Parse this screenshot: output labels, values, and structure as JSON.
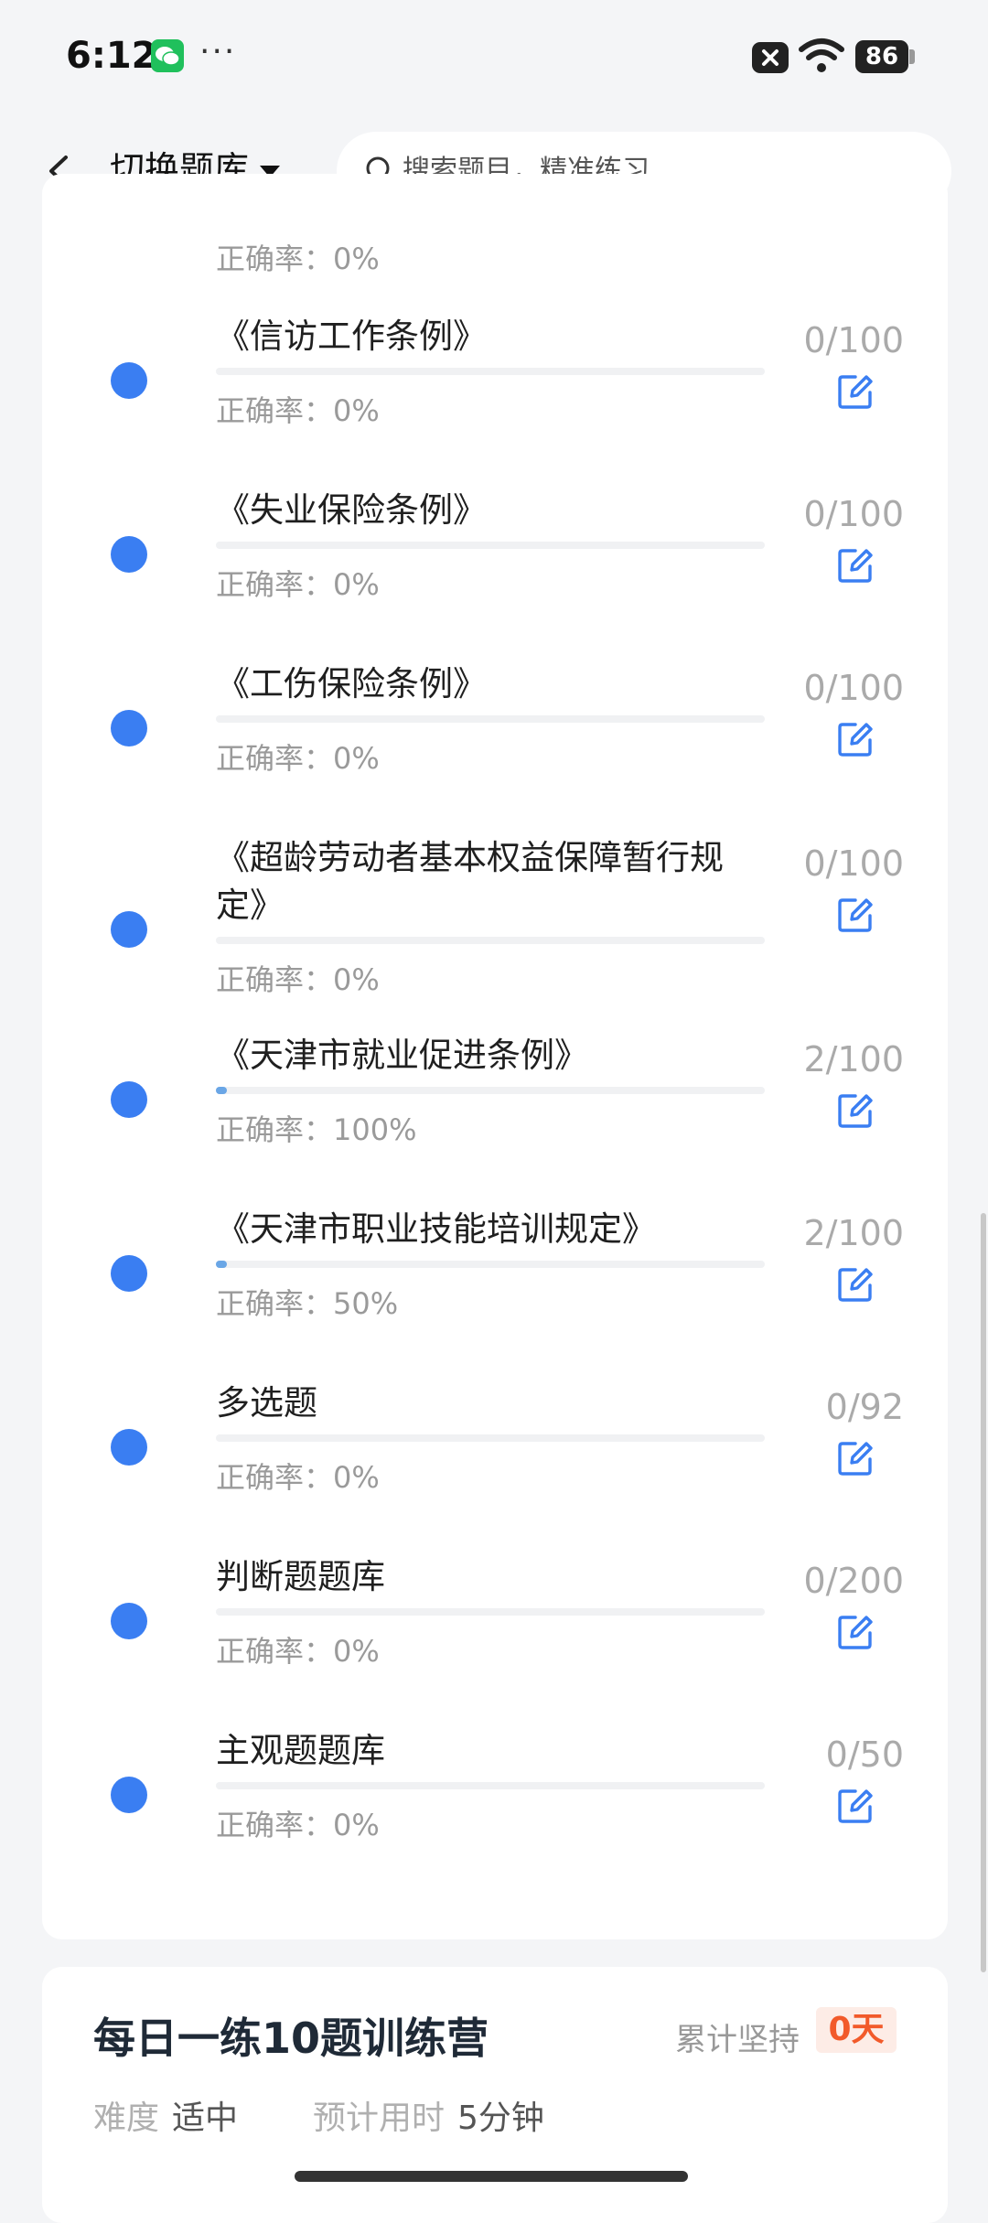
{
  "status": {
    "time": "6:12",
    "dots": "···",
    "battery": "86"
  },
  "header": {
    "title": "切换题库",
    "search_placeholder": "搜索题目，精准练习"
  },
  "partial_top_accuracy": "0%",
  "accuracy_label": "正确率：",
  "items": [
    {
      "title": "《信访工作条例》",
      "count": "0/100",
      "accuracy": "0%",
      "progress": 0.0
    },
    {
      "title": "《失业保险条例》",
      "count": "0/100",
      "accuracy": "0%",
      "progress": 0.0
    },
    {
      "title": "《工伤保险条例》",
      "count": "0/100",
      "accuracy": "0%",
      "progress": 0.0
    },
    {
      "title": "《超龄劳动者基本权益保障暂行规定》",
      "count": "0/100",
      "accuracy": "0%",
      "progress": 0.0
    },
    {
      "title": "《天津市就业促进条例》",
      "count": "2/100",
      "accuracy": "100%",
      "progress": 0.02
    },
    {
      "title": "《天津市职业技能培训规定》",
      "count": "2/100",
      "accuracy": "50%",
      "progress": 0.02
    },
    {
      "title": "多选题",
      "count": "0/92",
      "accuracy": "0%",
      "progress": 0.0
    },
    {
      "title": "判断题题库",
      "count": "0/200",
      "accuracy": "0%",
      "progress": 0.0
    },
    {
      "title": "主观题题库",
      "count": "0/50",
      "accuracy": "0%",
      "progress": 0.0
    }
  ],
  "camp": {
    "title": "每日一练10题训练营",
    "persist_label": "累计坚持",
    "days": "0天",
    "difficulty_label": "难度",
    "difficulty_value": "适中",
    "time_label": "预计用时",
    "time_value": "5分钟"
  },
  "colors": {
    "accent": "#3a7ef2",
    "badge_text": "#f25a2a",
    "badge_bg": "#fdece6"
  }
}
